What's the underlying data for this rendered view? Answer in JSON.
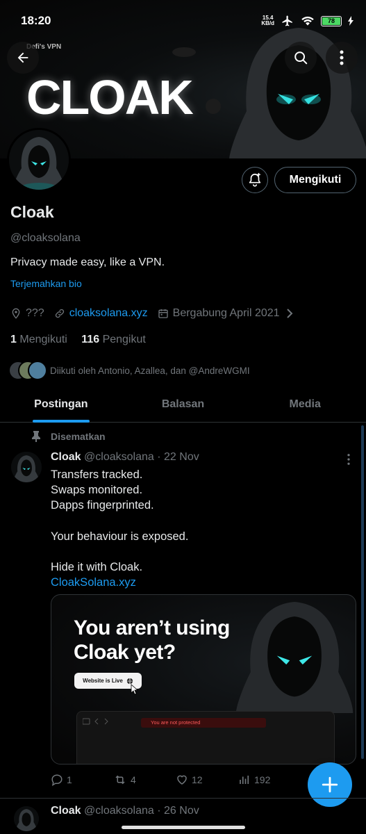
{
  "status_bar": {
    "time": "18:20",
    "net_speed_value": "15.4",
    "net_speed_unit": "KB/d",
    "battery": "78"
  },
  "banner": {
    "small_text": "Defi's VPN",
    "big_text": "CLOAK"
  },
  "profile": {
    "name": "Cloak",
    "handle": "@cloaksolana",
    "bio": "Privacy made easy, like a VPN.",
    "translate_bio": "Terjemahkan bio",
    "location": "???",
    "website": "cloaksolana.xyz",
    "joined": "Bergabung April 2021",
    "following_count": "1",
    "following_label": "Mengikuti",
    "followers_count": "116",
    "followers_label": "Pengikut",
    "followed_by": "Diikuti oleh Antonio, Azallea, dan @AndreWGMI"
  },
  "buttons": {
    "follow": "Mengikuti"
  },
  "tabs": [
    {
      "label": "Postingan",
      "active": true
    },
    {
      "label": "Balasan",
      "active": false
    },
    {
      "label": "Media",
      "active": false
    }
  ],
  "pinned_post": {
    "pinned_label": "Disematkan",
    "author_name": "Cloak",
    "author_handle": "@cloaksolana",
    "date": "22 Nov",
    "lines": [
      "Transfers tracked.",
      "Swaps monitored.",
      "Dapps fingerprinted.",
      "Your behaviour is exposed.",
      "Hide it with Cloak."
    ],
    "link": "CloakSolana.xyz",
    "media": {
      "headline_line1": "You aren’t using",
      "headline_line2": "Cloak yet?",
      "button": "Website is Live",
      "browser_warning": "You are not protected"
    },
    "stats": {
      "replies": "1",
      "reposts": "4",
      "likes": "12",
      "views": "192"
    }
  },
  "second_post": {
    "author_name": "Cloak",
    "author_handle": "@cloaksolana",
    "date": "26 Nov"
  },
  "colors": {
    "accent": "#1d9bf0",
    "background": "#000000",
    "text_primary": "#e7e9ea",
    "text_secondary": "#71767b",
    "glow_eyes": "#22d3d3"
  }
}
